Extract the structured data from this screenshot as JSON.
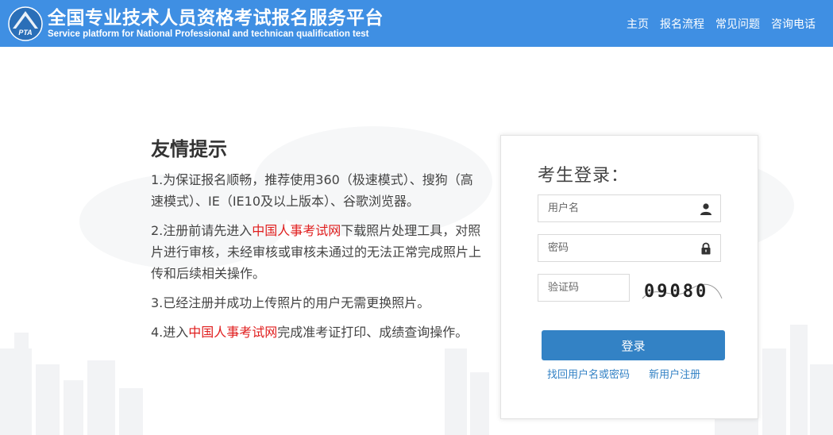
{
  "header": {
    "title": "全国专业技术人员资格考试报名服务平台",
    "subtitle": "Service platform for National Professional and technican qualification test",
    "logo_text": "PTA",
    "nav": [
      "主页",
      "报名流程",
      "常见问题",
      "咨询电话"
    ]
  },
  "tips": {
    "heading": "友情提示",
    "items": [
      {
        "before": "1.为保证报名顺畅，推荐使用360（极速模式）、搜狗（高速模式）、IE（IE10及以上版本）、谷歌浏览器。",
        "link": "",
        "after": ""
      },
      {
        "before": "2.注册前请先进入",
        "link": "中国人事考试网",
        "after": "下载照片处理工具，对照片进行审核，未经审核或审核未通过的无法正常完成照片上传和后续相关操作。"
      },
      {
        "before": "3.已经注册并成功上传照片的用户无需更换照片。",
        "link": "",
        "after": ""
      },
      {
        "before": "4.进入",
        "link": "中国人事考试网",
        "after": "完成准考证打印、成绩查询操作。"
      }
    ]
  },
  "login": {
    "title": "考生登录：",
    "username_placeholder": "用户名",
    "password_placeholder": "密码",
    "captcha_placeholder": "验证码",
    "captcha_text": "09080",
    "submit_label": "登录",
    "recover_label": "找回用户名或密码",
    "register_label": "新用户注册"
  },
  "colors": {
    "header_bg": "#3f8fe3",
    "button_bg": "#3382c5",
    "link": "#3382c5",
    "highlight": "#e01d1d"
  },
  "icons": {
    "username": "user-icon",
    "password": "lock-icon"
  }
}
